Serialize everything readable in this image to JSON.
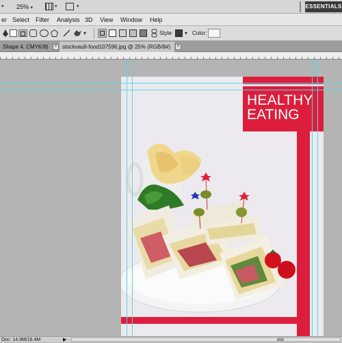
{
  "appbar": {
    "zoom": "25%",
    "workspace": "ESSENTIALS"
  },
  "menus": [
    "er",
    "Select",
    "Filter",
    "Analysis",
    "3D",
    "View",
    "Window",
    "Help"
  ],
  "options": {
    "style_label": "Style:",
    "color_label": "Color:"
  },
  "tabs": [
    {
      "label": "Shape 4, CMYK/8) *",
      "active": false
    },
    {
      "label": "stockvault-food107596.jpg @ 25% (RGB/8#)",
      "active": true
    }
  ],
  "document": {
    "title_line1": "HEALTHY",
    "title_line2": "EATING",
    "accent_color": "#dc1e3c"
  },
  "status": {
    "doc_size": "Doc: 14.9M/16.4M"
  }
}
